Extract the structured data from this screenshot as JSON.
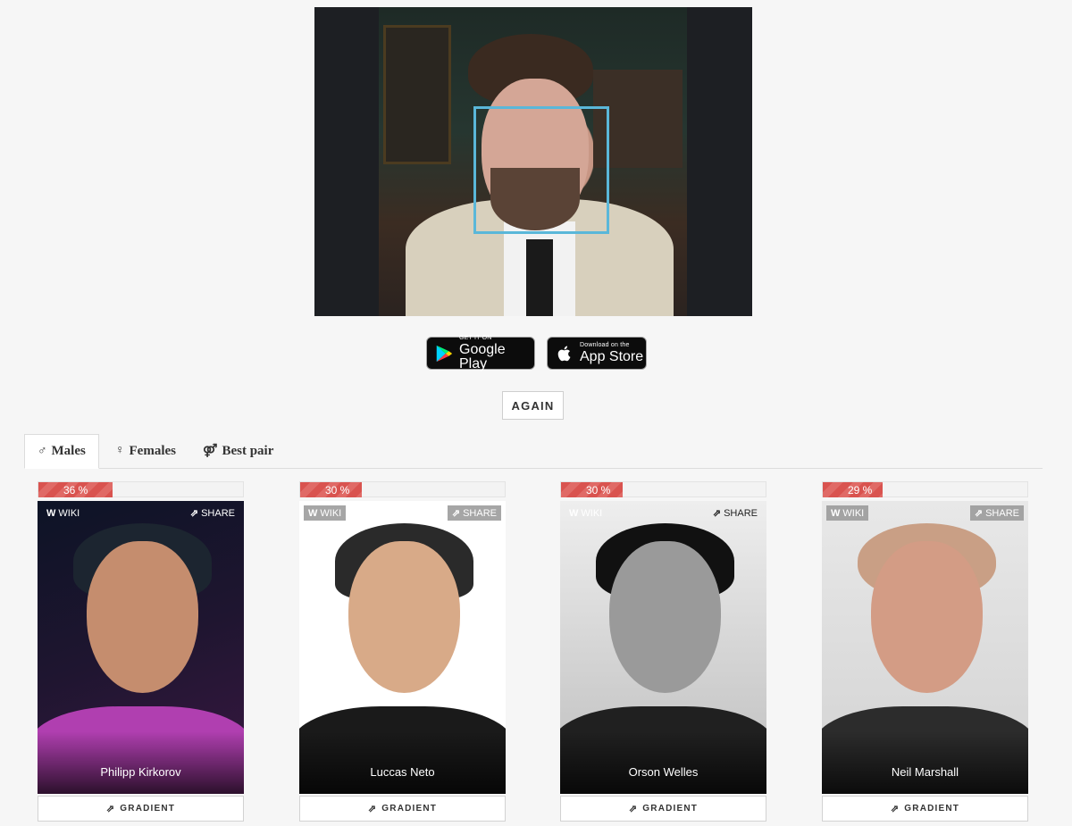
{
  "uploaded_photo": {
    "description_icon": "face-detection-box"
  },
  "stores": {
    "google": {
      "small": "GET IT ON",
      "big": "Google Play"
    },
    "apple": {
      "small": "Download on the",
      "big": "App Store"
    }
  },
  "again_label": "AGAIN",
  "tabs": [
    {
      "icon": "♂",
      "label": "Males",
      "active": true
    },
    {
      "icon": "♀",
      "label": "Females",
      "active": false
    },
    {
      "icon": "⚤",
      "label": "Best pair",
      "active": false
    }
  ],
  "cards": [
    {
      "percent_label": "36 %",
      "percent": 36,
      "name": "Philipp Kirkorov",
      "wiki": "WIKI",
      "share": "SHARE",
      "gradient": "GRADIENT",
      "accent": "#b03fb0"
    },
    {
      "percent_label": "30 %",
      "percent": 30,
      "name": "Luccas Neto",
      "wiki": "WIKI",
      "share": "SHARE",
      "gradient": "GRADIENT",
      "accent": "#1a1a1a"
    },
    {
      "percent_label": "30 %",
      "percent": 30,
      "name": "Orson Welles",
      "wiki": "WIKI",
      "share": "SHARE",
      "gradient": "GRADIENT",
      "accent": "#222222"
    },
    {
      "percent_label": "29 %",
      "percent": 29,
      "name": "Neil Marshall",
      "wiki": "WIKI",
      "share": "SHARE",
      "gradient": "GRADIENT",
      "accent": "#2c2c2c"
    }
  ],
  "colors": {
    "accent_red": "#d9534f",
    "face_box": "#5ab7d9"
  }
}
